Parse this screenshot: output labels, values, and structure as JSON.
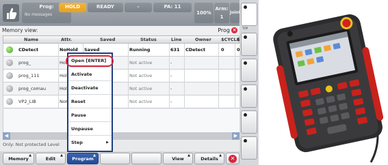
{
  "status_bar": {
    "prog_label": "Prog:",
    "messages_label": "No messages",
    "hold_label": "HOLD",
    "ready_label": "READY",
    "dash_label": "-",
    "pa_label": "PA: 11",
    "speed_label": "100%",
    "arm_label": "Arm: 1",
    "joint_label": "Joint",
    "hold_color": "#f3b43c"
  },
  "side_keys": {
    "top_label": "TOP"
  },
  "memory_view": {
    "title": "Memory view:",
    "prog_label": "Prog",
    "columns": [
      "Name",
      "Attr.",
      "Saved",
      "Status",
      "Line",
      "Owner",
      "$CYCLE",
      "$"
    ],
    "rows": [
      {
        "name": "CDetect",
        "attr": "NoHold",
        "saved": "Saved",
        "status": "Running",
        "line": "631",
        "owner": "CDetect",
        "cycle": "0",
        "extra": "0",
        "state": "green"
      },
      {
        "name": "prog_",
        "attr": "Hold",
        "saved": "",
        "status": "Not active",
        "line": "-",
        "owner": "",
        "cycle": "",
        "extra": "",
        "state": "grey"
      },
      {
        "name": "prog_111",
        "attr": "Hold",
        "saved": "",
        "status": "Not active",
        "line": "-",
        "owner": "",
        "cycle": "",
        "extra": "",
        "state": "grey"
      },
      {
        "name": "prog_comau",
        "attr": "Hold",
        "saved": "",
        "status": "Not active",
        "line": "-",
        "owner": "",
        "cycle": "",
        "extra": "",
        "state": "grey"
      },
      {
        "name": "VP2_LIB",
        "attr": "NoH",
        "saved": "",
        "status": "Not active",
        "line": "-",
        "owner": "",
        "cycle": "",
        "extra": "",
        "state": "grey"
      }
    ],
    "status_line": "Only: Not protected Level"
  },
  "popup_menu": {
    "items": [
      "Open [ENTER]",
      "Activate",
      "Deactivate",
      "Reset",
      "Pause",
      "Unpause",
      "Step"
    ],
    "highlight_color": "#d7263d"
  },
  "bottom_keys": {
    "memory": "Memory",
    "edit": "Edit",
    "program": "Program",
    "view": "View",
    "details": "Details",
    "close_glyph": "✕"
  }
}
